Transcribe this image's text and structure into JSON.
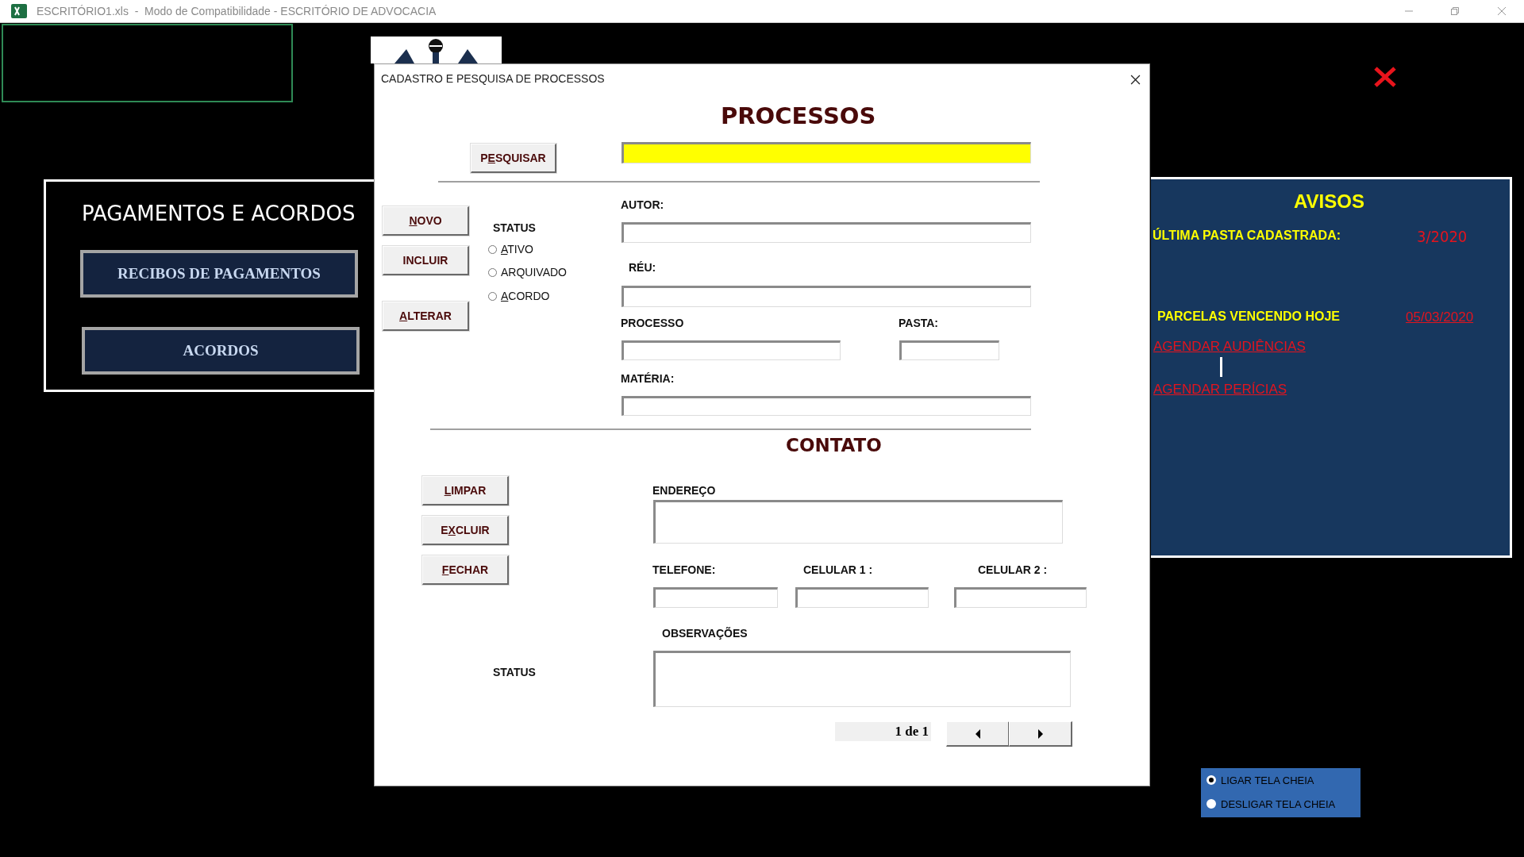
{
  "window": {
    "title": "ESCRITÓRIO1.xls  -  Modo de Compatibilidade - ESCRITÓRIO DE ADVOCACIA"
  },
  "payments_panel": {
    "title": "PAGAMENTOS E ACORDOS",
    "buttons": [
      "RECIBOS DE PAGAMENTOS",
      "ACORDOS"
    ]
  },
  "notices": {
    "title": "AVISOS",
    "last_folder_label": "ÚLTIMA PASTA CADASTRADA:",
    "last_folder_value": "3/2020",
    "due_label": "PARCELAS VENCENDO HOJE",
    "due_date": "05/03/2020",
    "links": [
      "AGENDAR AUDIÊNCIAS",
      "AGENDAR PERÍCIAS"
    ]
  },
  "screen_options": [
    {
      "label": "LIGAR TELA CHEIA",
      "selected": true
    },
    {
      "label": "DESLIGAR TELA CHEIA",
      "selected": false
    }
  ],
  "dialog": {
    "title": "CADASTRO E PESQUISA DE PROCESSOS",
    "heading": "PROCESSOS",
    "contact_heading": "CONTATO",
    "search_button": {
      "pre": "P",
      "key": "E",
      "post": "SQUISAR"
    },
    "buttons": [
      {
        "key": "N",
        "post": "OVO"
      },
      {
        "pre": "INCLUIR"
      },
      {
        "key": "A",
        "post": "LTERAR"
      },
      {
        "key": "L",
        "post": "IMPAR"
      },
      {
        "pre": "E",
        "key": "X",
        "post": "CLUIR"
      },
      {
        "key": "F",
        "post": "ECHAR"
      }
    ],
    "status_label": "STATUS",
    "status_options": [
      {
        "key": "A",
        "post": "TIVO",
        "selected": false
      },
      {
        "pre": "ARQUIVADO",
        "selected": false
      },
      {
        "key": "A",
        "post": "CORDO",
        "selected": false
      }
    ],
    "fields": [
      {
        "label": "AUTOR:"
      },
      {
        "label": "RÉU:"
      },
      {
        "label": "PROCESSO"
      },
      {
        "label": "PASTA:"
      },
      {
        "label": "MATÉRIA:"
      },
      {
        "label": "ENDEREÇO"
      },
      {
        "label": "TELEFONE:"
      },
      {
        "label": "CELULAR 1 :"
      },
      {
        "label": "CELULAR 2 :"
      },
      {
        "label": "OBSERVAÇÕES"
      }
    ],
    "status_label_2": "STATUS",
    "page_indicator": "1 de 1"
  }
}
